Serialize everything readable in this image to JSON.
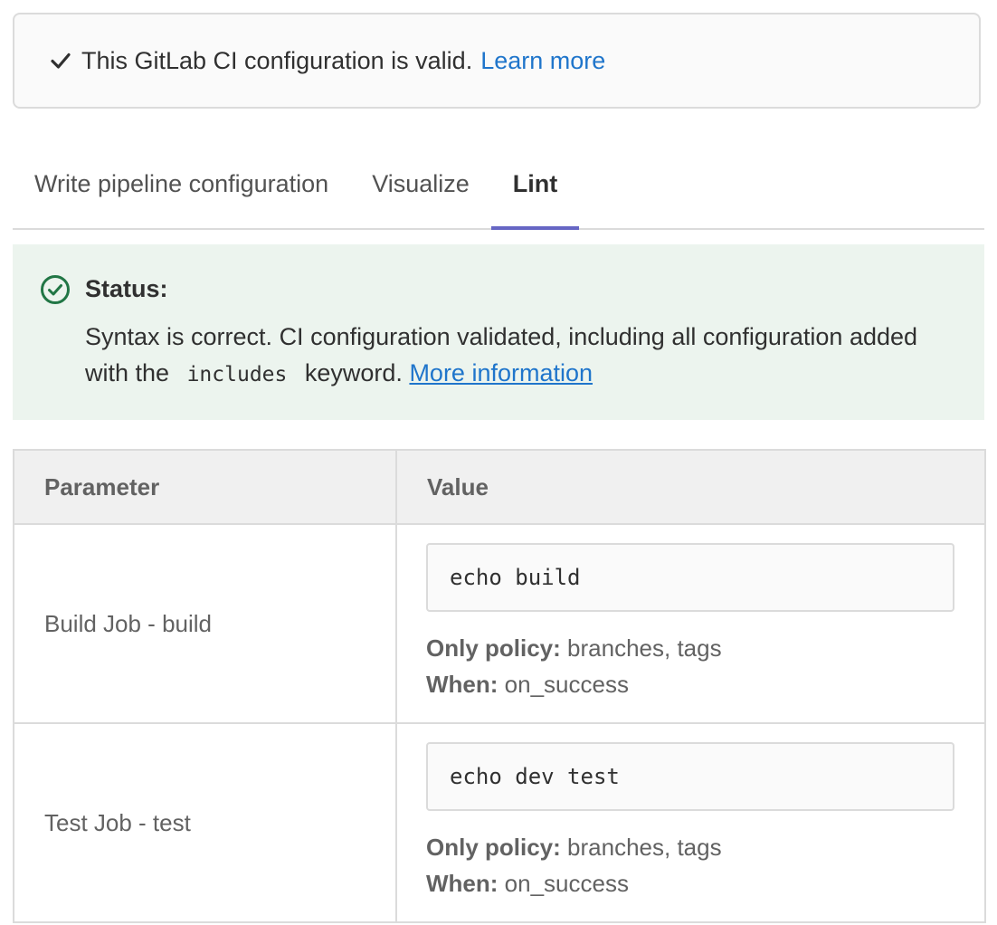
{
  "validity": {
    "message": "This GitLab CI configuration is valid.",
    "link": "Learn more"
  },
  "tabs": [
    {
      "label": "Write pipeline configuration",
      "active": false
    },
    {
      "label": "Visualize",
      "active": false
    },
    {
      "label": "Lint",
      "active": true
    }
  ],
  "status": {
    "title": "Status:",
    "message_before": "Syntax is correct. CI configuration validated, including all configuration added with the",
    "keyword": "includes",
    "message_after": "keyword.",
    "link": "More information"
  },
  "table": {
    "headers": [
      "Parameter",
      "Value"
    ],
    "rows": [
      {
        "parameter": "Build Job - build",
        "script": "echo build",
        "only_label": "Only policy:",
        "only_value": "branches, tags",
        "when_label": "When:",
        "when_value": "on_success"
      },
      {
        "parameter": "Test Job - test",
        "script": "echo dev test",
        "only_label": "Only policy:",
        "only_value": "branches, tags",
        "when_label": "When:",
        "when_value": "on_success"
      }
    ]
  },
  "colors": {
    "link": "#1f75cb",
    "success": "#217645",
    "active_tab_underline": "#6666c4",
    "status_background": "#ecf4ee"
  },
  "icons": {
    "validity": "check-icon",
    "status": "check-circle-icon"
  }
}
